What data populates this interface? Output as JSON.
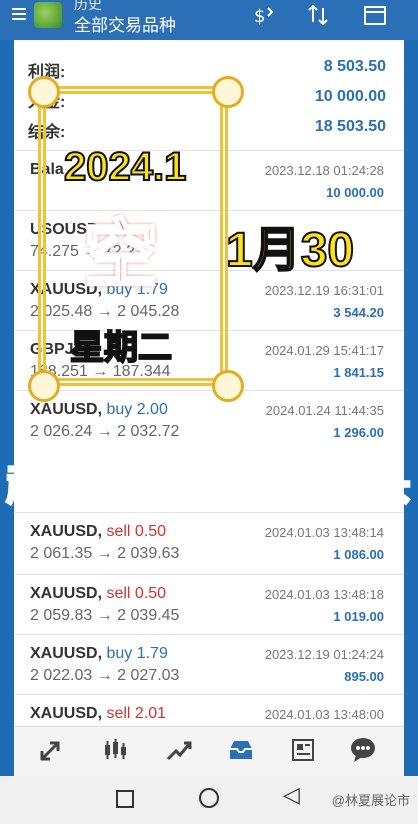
{
  "topbar": {
    "small_title": "历史",
    "title": "全部交易品种",
    "icons": [
      "menu-icon",
      "app-logo",
      "deposit-icon",
      "sort-icon",
      "calendar-icon"
    ]
  },
  "summary": [
    {
      "label": "利润:",
      "value": "8 503.50"
    },
    {
      "label": "入金:",
      "value": "10 000.00"
    },
    {
      "label": "结余:",
      "value": "18 503.50"
    }
  ],
  "trades": [
    {
      "symbol": "Bala",
      "side": "",
      "side_type": "",
      "prices": "",
      "time": "2023.12.18 01:24:28",
      "profit": "10 000.00"
    },
    {
      "symbol": "USOUSD",
      "side": "",
      "side_type": "",
      "prices": "74.275 → 72.23",
      "time": "",
      "profit": ""
    },
    {
      "symbol": "XAUUSD,",
      "side": "buy 1.79",
      "side_type": "buy",
      "prices": "2 025.48 → 2 045.28",
      "time": "2023.12.19 16:31:01",
      "profit": "3 544.20"
    },
    {
      "symbol": "GBPJ",
      "side": "",
      "side_type": "",
      "prices": "188.251 → 187.344",
      "time": "2024.01.29 15:41:17",
      "profit": "1 841.15"
    },
    {
      "symbol": "XAUUSD,",
      "side": "buy 2.00",
      "side_type": "buy",
      "prices": "2 026.24 → 2 032.72",
      "time": "2024.01.24 11:44:35",
      "profit": "1 296.00"
    },
    {
      "symbol": "XAUUSD,",
      "side": "sell 0.50",
      "side_type": "sell",
      "prices": "2 061.35 → 2 039.63",
      "time": "2024.01.03 13:48:14",
      "profit": "1 086.00"
    },
    {
      "symbol": "XAUUSD,",
      "side": "sell 0.50",
      "side_type": "sell",
      "prices": "2 059.83 → 2 039.45",
      "time": "2024.01.03 13:48:18",
      "profit": "1 019.00"
    },
    {
      "symbol": "XAUUSD,",
      "side": "buy 1.79",
      "side_type": "buy",
      "prices": "2 022.03 → 2 027.03",
      "time": "2023.12.19 01:24:24",
      "profit": "895.00"
    },
    {
      "symbol": "XAUUSD,",
      "side": "sell 2.01",
      "side_type": "sell",
      "prices": "",
      "time": "2024.01.03 13:48:00",
      "profit": ""
    }
  ],
  "toolbar": {
    "icons": [
      "quotes-icon",
      "chart-icon",
      "trade-icon",
      "history-icon",
      "news-icon",
      "chat-icon"
    ],
    "active": "history-icon"
  },
  "navbar": {
    "watermark": "@林夏展论市"
  },
  "overlay": {
    "year": "2024.1",
    "kong": "空",
    "date": "1月30",
    "weekday": "星期二",
    "headline": "超级周博弈加空空头"
  },
  "colors": {
    "topbar": "#2b6fb6",
    "buy": "#2b6fb6",
    "sell": "#d6332c",
    "overlay_yellow": "#ffe11a",
    "overlay_red": "#ff3b3b"
  }
}
